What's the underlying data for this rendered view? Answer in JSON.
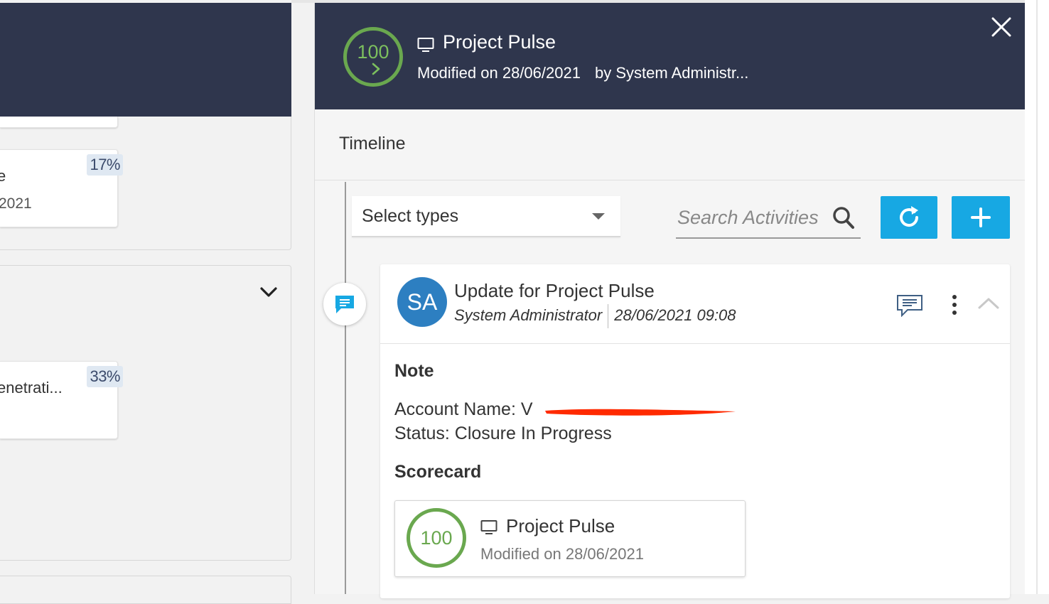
{
  "background_board": {
    "card_b": {
      "percent": "17%",
      "title_fragment": "e",
      "date_fragment": "2021"
    },
    "card_c": {
      "percent": "33%",
      "title_fragment": "enetrati..."
    }
  },
  "panel": {
    "header": {
      "score": "100",
      "title": "Project Pulse",
      "modified": "Modified on 28/06/2021",
      "by": "by System Administr..."
    },
    "tabs": [
      {
        "label": "Timeline"
      }
    ],
    "filters": {
      "select_types_label": "Select types",
      "search_placeholder": "Search Activities"
    },
    "activity": {
      "avatar_initials": "SA",
      "title": "Update for Project Pulse",
      "author": "System Administrator",
      "datetime": "28/06/2021 09:08",
      "note_heading": "Note",
      "account_line": "Account Name: V",
      "status_line": "Status: Closure In Progress",
      "scorecard_heading": "Scorecard",
      "scorecard": {
        "score": "100",
        "title": "Project Pulse",
        "modified": "Modified on 28/06/2021"
      }
    }
  },
  "colors": {
    "header_bg": "#2f364d",
    "accent_blue": "#17a8e3",
    "score_green": "#6aa84f",
    "avatar_blue": "#2d7fc1",
    "redaction_red": "#ff2a00"
  }
}
